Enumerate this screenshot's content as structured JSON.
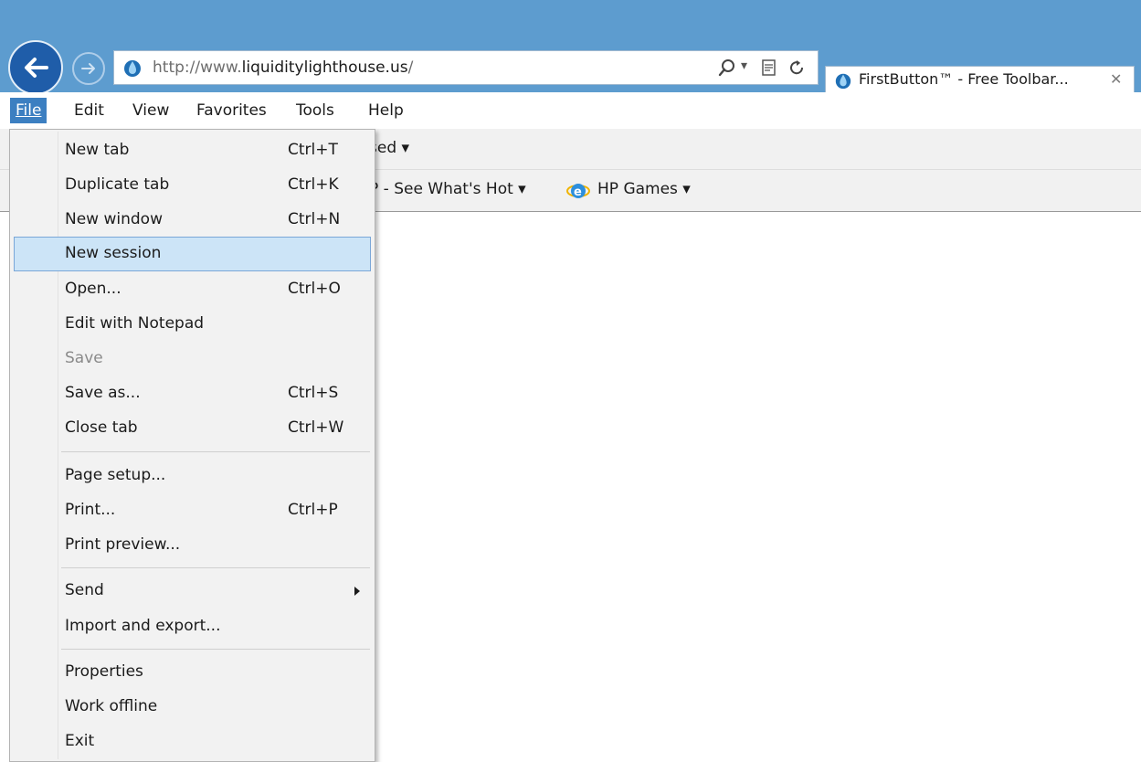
{
  "address_bar": {
    "url_prefix": "http://www.",
    "url_domain": "liquiditylighthouse.us",
    "url_suffix": "/"
  },
  "tab": {
    "title": "FirstButton™ - Free Toolbar...",
    "close_glyph": "✕"
  },
  "menubar": {
    "file": "File",
    "edit": "Edit",
    "view": "View",
    "favorites": "Favorites",
    "tools": "Tools",
    "help": "Help"
  },
  "command_bar": {
    "fragment": "sed ▾"
  },
  "favorites_bar": {
    "hp_hot": "P - See What's Hot ▾",
    "hp_games": "HP Games ▾"
  },
  "file_menu": {
    "items": [
      {
        "label": "New tab",
        "shortcut": "Ctrl+T"
      },
      {
        "label": "Duplicate tab",
        "shortcut": "Ctrl+K"
      },
      {
        "label": "New window",
        "shortcut": "Ctrl+N"
      },
      {
        "label": "New session",
        "shortcut": ""
      },
      {
        "label": "Open...",
        "shortcut": "Ctrl+O"
      },
      {
        "label": "Edit with Notepad",
        "shortcut": ""
      },
      {
        "label": "Save",
        "shortcut": ""
      },
      {
        "label": "Save as...",
        "shortcut": "Ctrl+S"
      },
      {
        "label": "Close tab",
        "shortcut": "Ctrl+W"
      },
      {
        "label": "Page setup...",
        "shortcut": ""
      },
      {
        "label": "Print...",
        "shortcut": "Ctrl+P"
      },
      {
        "label": "Print preview...",
        "shortcut": ""
      },
      {
        "label": "Send",
        "shortcut": ""
      },
      {
        "label": "Import and export...",
        "shortcut": ""
      },
      {
        "label": "Properties",
        "shortcut": ""
      },
      {
        "label": "Work offline",
        "shortcut": ""
      },
      {
        "label": "Exit",
        "shortcut": ""
      }
    ],
    "highlighted": "New session",
    "disabled": [
      "Save"
    ]
  },
  "colors": {
    "titlebar": "#5d9ccf",
    "menu_active": "#3c7fc1",
    "menu_highlight": "#cce4f7"
  },
  "icons": {
    "back": "back-arrow-icon",
    "forward": "forward-arrow-icon",
    "favicon": "water-drop-icon",
    "search": "search-icon",
    "compat": "compatibility-view-icon",
    "refresh": "refresh-icon",
    "ie": "ie-logo-icon",
    "submenu": "submenu-arrow-icon"
  }
}
